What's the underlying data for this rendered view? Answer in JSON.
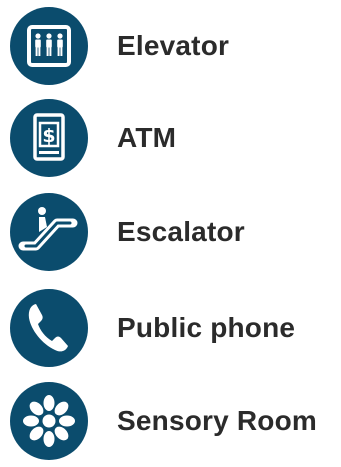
{
  "colors": {
    "icon_bg": "#0b4c6d",
    "icon_fg": "#ffffff",
    "label": "#2b2b2b"
  },
  "items": [
    {
      "label": "Elevator",
      "icon": "elevator-icon"
    },
    {
      "label": "ATM",
      "icon": "atm-icon"
    },
    {
      "label": "Escalator",
      "icon": "escalator-icon"
    },
    {
      "label": "Public phone",
      "icon": "phone-icon"
    },
    {
      "label": "Sensory Room",
      "icon": "sensory-room-icon"
    }
  ]
}
